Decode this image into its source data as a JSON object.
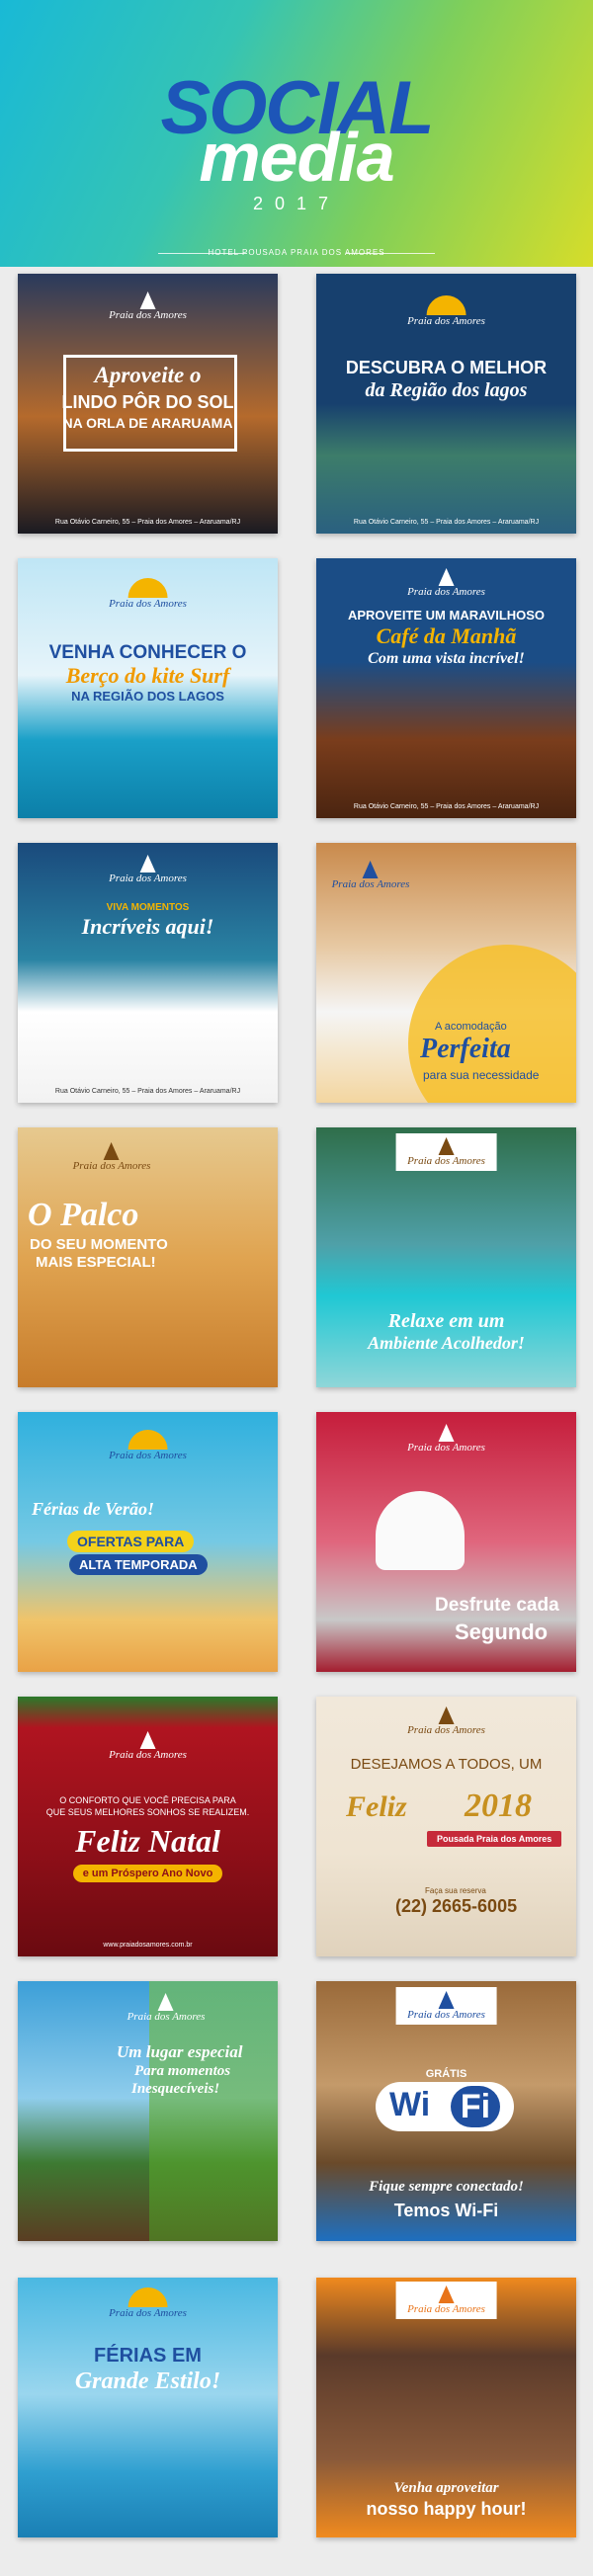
{
  "header": {
    "word1": "SOCIAL",
    "word2": "media",
    "year": "2017",
    "subtitle": "HOTEL POUSADA PRAIA DOS AMORES"
  },
  "brand": {
    "name": "Praia dos Amores",
    "address": "Rua Otávio Carneiro, 55 – Praia dos Amores – Araruama/RJ",
    "website": "www.praiadosamores.com.br"
  },
  "posts": {
    "p1": {
      "line1": "Aproveite o",
      "line2": "LINDO PÔR DO SOL",
      "line3": "NA ORLA DE ARARUAMA"
    },
    "p2": {
      "line1": "DESCUBRA O MELHOR",
      "line2": "da Região dos lagos"
    },
    "p3": {
      "line1": "VENHA CONHECER O",
      "line2": "Berço do kite Surf",
      "line3": "NA REGIÃO DOS LAGOS"
    },
    "p4": {
      "line1": "APROVEITE UM MARAVILHOSO",
      "line2": "Café da Manhã",
      "line3": "Com uma vista incrível!"
    },
    "p5": {
      "line1": "VIVA MOMENTOS",
      "line2": "Incríveis aqui!"
    },
    "p6": {
      "line1": "A acomodação",
      "line2": "Perfeita",
      "line3": "para sua necessidade"
    },
    "p7": {
      "line1": "O Palco",
      "line2": "DO SEU MOMENTO",
      "line3": "MAIS ESPECIAL!"
    },
    "p8": {
      "line1": "Relaxe em um",
      "line2": "Ambiente Acolhedor!"
    },
    "p9": {
      "line1": "Férias de Verão!",
      "line2": "OFERTAS PARA",
      "line3": "ALTA TEMPORADA"
    },
    "p10": {
      "line1": "Desfrute cada",
      "line2": "Segundo"
    },
    "p11": {
      "line1": "O CONFORTO QUE VOCÊ PRECISA PARA",
      "line2": "QUE SEUS MELHORES SONHOS SE REALIZEM.",
      "line3": "Feliz Natal",
      "line4": "e um Próspero Ano Novo"
    },
    "p12": {
      "line1": "DESEJAMOS A TODOS, UM",
      "line2": "Feliz",
      "line3": "2018",
      "line4": "Pousada Praia dos Amores",
      "line5": "Faça sua reserva",
      "line6": "(22) 2665-6005"
    },
    "p13": {
      "line1": "Um lugar especial",
      "line2": "Para momentos",
      "line3": "Inesquecíveis!"
    },
    "p14": {
      "line1": "GRÁTIS",
      "line2": "Wi",
      "line3": "Fi",
      "line4": "Fique sempre conectado!",
      "line5": "Temos Wi-Fi"
    },
    "p15": {
      "line1": "FÉRIAS EM",
      "line2": "Grande Estilo!"
    },
    "p16": {
      "line1": "Venha aproveitar",
      "line2": "nosso happy hour!"
    }
  },
  "colors": {
    "blue": "#1f4fa0",
    "yellow": "#f4b400",
    "red": "#c0141c",
    "green": "#5cae2f"
  }
}
